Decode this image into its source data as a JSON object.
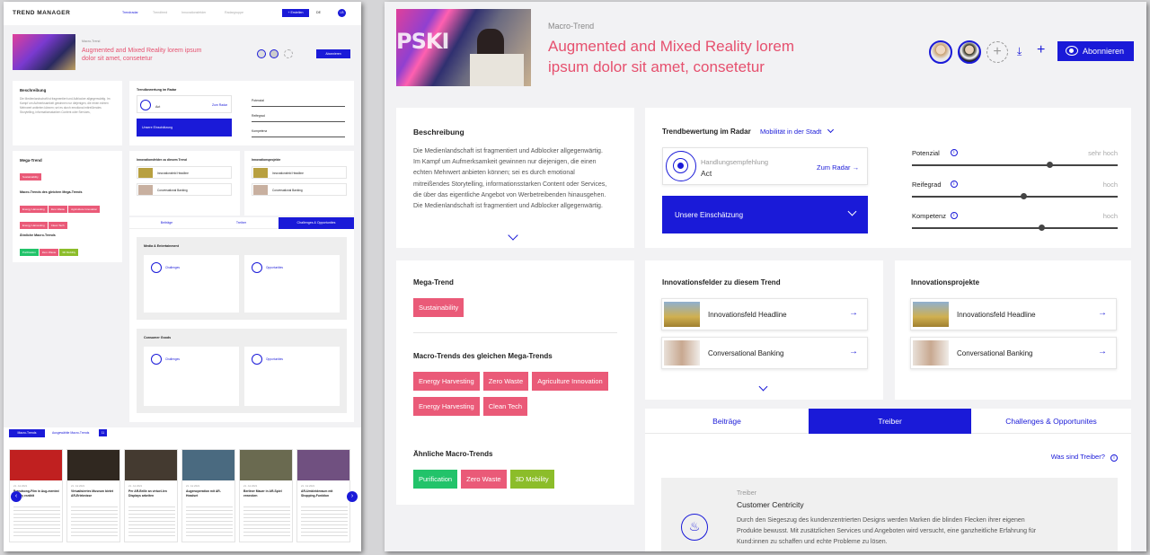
{
  "app": {
    "logo": "TREND MANAGER",
    "nav": [
      "Trendradar",
      "Trendfeed",
      "Innovationsfelder",
      "Radargruppe"
    ],
    "create": "+ Erstellen",
    "lang": "DE",
    "avatar": "LB"
  },
  "header": {
    "overline": "Macro-Trend",
    "title_line1": "Augmented and Mixed Reality lorem",
    "title_line2": "ipsum dolor sit amet, consetetur",
    "subscribe": "Abonnieren"
  },
  "description": {
    "title": "Beschreibung",
    "lines": [
      "Die Medienlandschaft ist fragmentiert und Adblocker allgegenwärtig.",
      "Im Kampf um Aufmerksamkeit gewinnen nur diejenigen, die einen",
      "echten Mehrwert anbieten können; sei es durch emotional",
      "mitreißendes Storytelling, informationsstarken Content oder Services,",
      "die über das eigentliche Angebot von Werbetreibenden hinausgehen.",
      "Die Medienlandschaft ist fragmentiert und Adblocker allgegenwärtig."
    ]
  },
  "rating": {
    "title": "Trendbewertung im Radar",
    "radar_select": "Mobilität in der Stadt",
    "recommendation_label": "Handlungsempfehlung",
    "recommendation_value": "Act",
    "to_radar": "Zum Radar",
    "assessment": "Unsere Einschätzung",
    "sliders": [
      {
        "label": "Potenzial",
        "hint": "sehr hoch",
        "value": 0.67
      },
      {
        "label": "Reifegrad",
        "hint": "hoch",
        "value": 0.54
      },
      {
        "label": "Kompetenz",
        "hint": "hoch",
        "value": 0.63
      }
    ]
  },
  "mega": {
    "title": "Mega-Trend",
    "tag": "Sustainability",
    "macro_title": "Macro-Trends des gleichen Mega-Trends",
    "macro_tags": [
      "Energy Harvesting",
      "Zero Waste",
      "Agriculture Innovation",
      "Energy Harvesting",
      "Clean Tech"
    ],
    "similar_title": "Ähnliche Macro-Trends",
    "similar_tags": [
      "Purification",
      "Zero Waste",
      "3D Mobility"
    ]
  },
  "innov_fields": {
    "title": "Innovationsfelder zu diesem Trend",
    "items": [
      "Innovationsfeld Headline",
      "Conversational Banking"
    ]
  },
  "innov_projects": {
    "title": "Innovationsprojekte",
    "items": [
      "Innovationsfeld Headline",
      "Conversational Banking"
    ]
  },
  "tabs": [
    "Beiträge",
    "Treiber",
    "Challenges & Opportunites"
  ],
  "drivers": {
    "link": "Was sind Treiber?",
    "overline": "Treiber",
    "title": "Customer Centricity",
    "lines": [
      "Durch den Siegeszug des kundenzentrierten Designs werden Marken die blinden Flecken ihrer eigenen",
      "Produkte bewusst. Mit zusätzlichen Services und Angeboten wird versucht, eine ganzheitliche Erfahrung für",
      "Kund:innen zu schaffen und echte Probleme zu lösen."
    ]
  },
  "left": {
    "challenges": {
      "sections": [
        "Media & Entertainment",
        "Consumer Goods"
      ],
      "challenges": "Challenges",
      "opportunities": "Opportunities"
    },
    "bottom_tabs": [
      "Macro-Trends",
      "Ausgewählte Macro-Trends"
    ],
    "bottom_count": "11",
    "news": [
      {
        "date": "21. Jul 2021",
        "title": "Brandsong-Film in Aug-mented Reality erzählt"
      },
      {
        "date": "21. Jul 2021",
        "title": "Virtualisiertes Museum bietet AR-Erlebnisse"
      },
      {
        "date": "21. Jul 2021",
        "title": "Per AR-Brille an virtuel-len Displays arbeiten"
      },
      {
        "date": "21. Jul 2021",
        "title": "Augenoperation mit AR-Headset"
      },
      {
        "date": "21. Jul 2021",
        "title": "Berliner Mauer in AR-Spiel erwecken"
      },
      {
        "date": "21. Jul 2021",
        "title": "AR-Umkleideraum mit Shopping-Funktion"
      }
    ]
  },
  "colors": {
    "accent": "#1a1ad8",
    "pink": "#e6506e",
    "green": "#22c36a",
    "olive": "#8cbd2a"
  }
}
